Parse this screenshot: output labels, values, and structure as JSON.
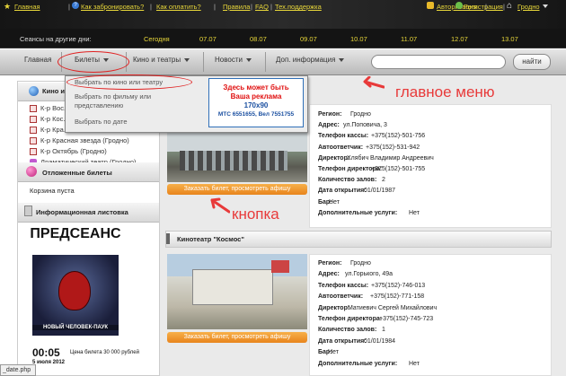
{
  "topbar": {
    "links": [
      "Главная",
      "Как забронировать?",
      "Как оплатить?",
      "Правила",
      "FAQ",
      "Тех.поддержка"
    ],
    "auth": "Авторизация",
    "register": "Регистрация",
    "city": "Гродно"
  },
  "dates": {
    "label": "Сеансы на другие дни:",
    "days": [
      "Сегодня",
      "07.07",
      "08.07",
      "09.07",
      "10.07",
      "11.07",
      "12.07",
      "13.07"
    ]
  },
  "menu": {
    "items": [
      "Главная",
      "Билеты",
      "Кино и театры",
      "Новости",
      "Доп. информация"
    ],
    "search_button": "найти",
    "dropdown": [
      "Выбрать по кино или театру",
      "Выбрать по фильму или представлению",
      "Выбрать по дате"
    ]
  },
  "sidebar": {
    "cinemas_title": "Кино и ...",
    "cinemas": [
      "К-р Вос...",
      "К-р Кос...",
      "К-р Кра... ...",
      "К-р Красная звезда (Гродно)",
      "К-р Октябрь (Гродно)",
      "Драматический театр (Гродно)"
    ],
    "deferred_title": "Отложенные билеты",
    "cart": "Корзина пуста",
    "info_title": "Информационная листовка",
    "poster": {
      "heading": "ПРЕДСЕАНС",
      "movie": "НОВЫЙ ЧЕЛОВЕК-ПАУК",
      "time": "00:05",
      "date": "5 июля 2012",
      "price": "Цена билета 30 000 рублей"
    }
  },
  "ad": {
    "line1": "Здесь может быть",
    "line2": "Ваша реклама",
    "line3": "170x90",
    "line4": "МТС 6551655, Вел 7551755"
  },
  "annotations": {
    "main_menu": "главное меню",
    "button": "кнопка"
  },
  "card1": {
    "rows": [
      [
        "Регион:",
        "Гродно"
      ],
      [
        "Адрес:",
        "ул.Поповича, 3"
      ],
      [
        "Телефон кассы:",
        "+375(152)-501-756"
      ],
      [
        "Автоответчик:",
        "+375(152)-531-942"
      ],
      [
        "Директор:",
        "Хлябич Владимир Андреевич"
      ],
      [
        "Телефон директора:",
        "+375(152)-501-755"
      ],
      [
        "Количество залов:",
        "2"
      ],
      [
        "Дата открытия:",
        "01/01/1987"
      ],
      [
        "Бар:",
        "Нет"
      ],
      [
        "Дополнительные услуги:",
        "Нет"
      ]
    ],
    "button": "Заказать билет, просмотреть афишу"
  },
  "card2": {
    "title": "Кинотеатр \"Космос\"",
    "rows": [
      [
        "Регион:",
        "Гродно"
      ],
      [
        "Адрес:",
        "ул.Горького, 49а"
      ],
      [
        "Телефон кассы:",
        "+375(152)-746-013"
      ],
      [
        "Автоответчик:",
        "+375(152)-771-158"
      ],
      [
        "Директор:",
        "Матиевич Сергей Михайлович"
      ],
      [
        "Телефон директора:",
        "+375(152)-745-723"
      ],
      [
        "Количество залов:",
        "1"
      ],
      [
        "Дата открытия:",
        "01/01/1984"
      ],
      [
        "Бар:",
        "Нет"
      ],
      [
        "Дополнительные услуги:",
        "Нет"
      ]
    ],
    "button": "Заказать билет, просмотреть афишу"
  },
  "status": "_date.php"
}
